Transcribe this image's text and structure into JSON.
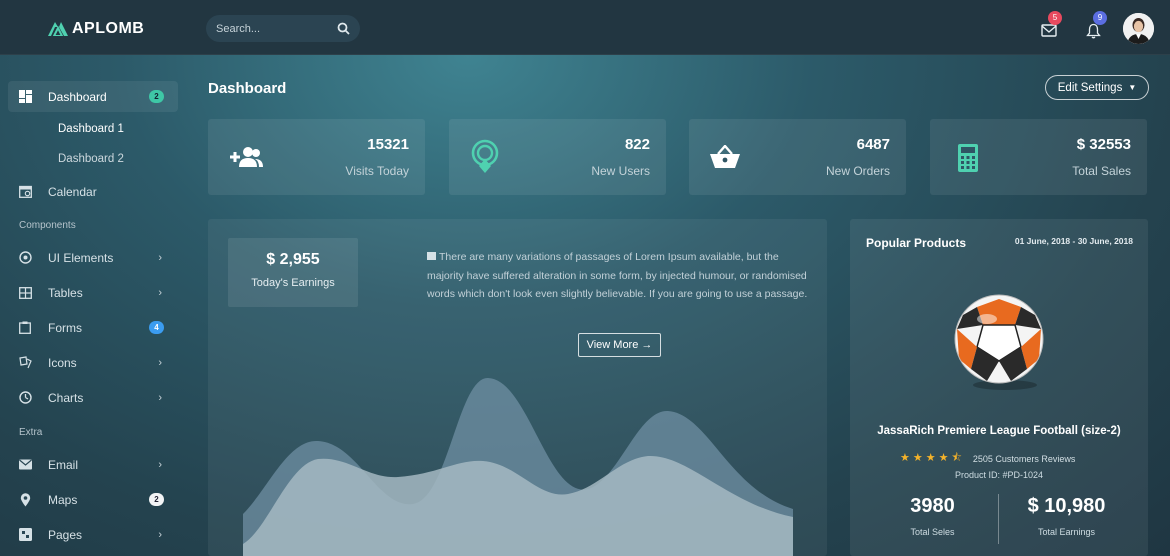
{
  "topbar": {
    "brand": "APLOMB",
    "search_placeholder": "Search...",
    "mail_count": "5",
    "bell_count": "9",
    "colors": {
      "mail_badge": "#e84a5f",
      "bell_badge": "#5b6ee1"
    }
  },
  "sidebar": {
    "dashboard": {
      "label": "Dashboard",
      "badge": "2"
    },
    "sub": [
      "Dashboard 1",
      "Dashboard 2"
    ],
    "calendar": "Calendar",
    "components_label": "Components",
    "components": [
      {
        "label": "UI Elements",
        "icon": "target-icon"
      },
      {
        "label": "Tables",
        "icon": "table-icon"
      },
      {
        "label": "Forms",
        "icon": "clipboard-icon",
        "badge": "4"
      },
      {
        "label": "Icons",
        "icon": "icons-icon"
      },
      {
        "label": "Charts",
        "icon": "chart-icon"
      }
    ],
    "extra_label": "Extra",
    "extra": [
      {
        "label": "Email",
        "icon": "mail-icon"
      },
      {
        "label": "Maps",
        "icon": "map-pin-icon",
        "badge": "2"
      },
      {
        "label": "Pages",
        "icon": "pages-icon"
      }
    ]
  },
  "header": {
    "title": "Dashboard",
    "edit_settings": "Edit Settings"
  },
  "stats": [
    {
      "value": "15321",
      "label": "Visits Today",
      "icon": "add-user-icon"
    },
    {
      "value": "822",
      "label": "New Users",
      "icon": "location-icon"
    },
    {
      "value": "6487",
      "label": "New Orders",
      "icon": "basket-icon"
    },
    {
      "value": "$ 32553",
      "label": "Total Sales",
      "icon": "calculator-icon"
    }
  ],
  "earnings": {
    "value": "$ 2,955",
    "label": "Today's Earnings",
    "text": "There are many variations of passages of Lorem Ipsum available, but the majority have suffered alteration in some form, by injected humour, or randomised words which don't look even slightly believable. If you are going to use a passage.",
    "button": "View More →"
  },
  "product": {
    "title": "Popular Products",
    "date_range": "01 June, 2018 - 30 June, 2018",
    "name": "JassaRich Premiere League Football (size-2)",
    "rating": 4.5,
    "reviews": "2505 Customers Reviews",
    "product_id": "Product ID: #PD-1024",
    "sales": "3980",
    "sales_label": "Total Seles",
    "earnings": "$ 10,980",
    "earnings_label": "Total Earnings"
  },
  "colors": {
    "accent": "#4fd1b0",
    "badge_teal": "#3ec7a6",
    "badge_blue": "#3b9cf0"
  }
}
